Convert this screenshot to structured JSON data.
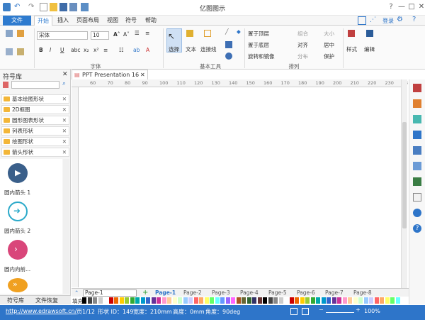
{
  "app": {
    "title": "亿图图示"
  },
  "tabs": [
    "文件",
    "开始",
    "插入",
    "页面布局",
    "视图",
    "符号",
    "帮助"
  ],
  "login": "登录",
  "ribbon": {
    "font_name": "宋体",
    "font_size": "10",
    "font_group": "字体",
    "select_label": "选择",
    "text_label": "文本",
    "connector_label": "连接线",
    "basic_tools": "基本工具",
    "bring_front": "置于顶层",
    "send_back": "置于底层",
    "rotate_mirror": "旋转和镜像",
    "group": "组合",
    "align": "对齐",
    "distribute": "分布",
    "size": "大小",
    "center": "居中",
    "protect": "保护",
    "arrange_group": "排列",
    "style_label": "样式",
    "edit_label": "编辑"
  },
  "symbols": {
    "title": "符号库",
    "categories": [
      "基本绘图形状",
      "2D框图",
      "圆形图表形状",
      "列表形状",
      "绘图形状",
      "箭头形状"
    ],
    "shapes": [
      {
        "label": "圆内箭头 1",
        "color": "#3a5f8a"
      },
      {
        "label": "圆内箭头 2",
        "color": "#2aa9c9"
      },
      {
        "label": "圆内向前...",
        "color": "#d9467a"
      }
    ],
    "bottom_tabs": [
      "符号库",
      "文件恢复"
    ]
  },
  "document": {
    "tab": "PPT Presentation 16"
  },
  "ruler_ticks": [
    "60",
    "70",
    "80",
    "90",
    "100",
    "110",
    "120",
    "130",
    "140",
    "150",
    "160",
    "170",
    "180",
    "190",
    "200",
    "210",
    "220",
    "230",
    "24"
  ],
  "pages": {
    "current_select": "Page-1",
    "list": [
      "Page-1",
      "Page-2",
      "Page-3",
      "Page-4",
      "Page-5",
      "Page-6",
      "Page-7",
      "Page-8"
    ]
  },
  "fill_label": "填充",
  "status": {
    "url": "http://www.edrawsoft.cn/",
    "page": "页1/12",
    "shape_id": "形状 ID：149",
    "width": "宽度：210mm",
    "height": "高度：0mm",
    "angle": "角度：90deg",
    "zoom": "100%"
  },
  "colors": {
    "accent": "#2e75c9",
    "file_tab": "#2e7bcf"
  }
}
